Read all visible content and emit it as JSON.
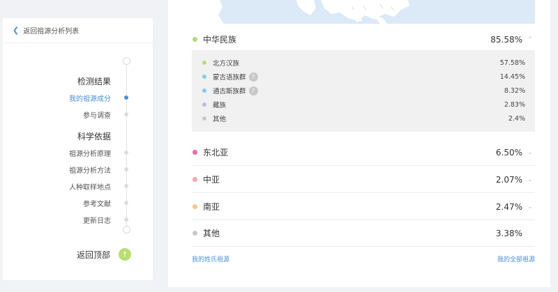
{
  "sidebar": {
    "back_label": "返回祖源分析列表",
    "nav": [
      {
        "label": "检测结果",
        "type": "heading"
      },
      {
        "label": "我的祖源成分",
        "type": "item",
        "active": true
      },
      {
        "label": "参与调查",
        "type": "item"
      },
      {
        "label": "科学依据",
        "type": "heading"
      },
      {
        "label": "祖源分析原理",
        "type": "item"
      },
      {
        "label": "祖源分析方法",
        "type": "item"
      },
      {
        "label": "人种取样地点",
        "type": "item"
      },
      {
        "label": "参考文献",
        "type": "item"
      },
      {
        "label": "更新日志",
        "type": "item"
      }
    ],
    "back_top_label": "返回顶部",
    "back_top_color": "#b8dd73"
  },
  "main": {
    "regions": [
      {
        "name": "中华民族",
        "percent": "85.58%",
        "color": "#b5dc78",
        "expanded": true,
        "icon": "chevron-up-icon"
      },
      {
        "name": "东北亚",
        "percent": "6.50%",
        "color": "#e968a6",
        "icon": "chevron-down-icon"
      },
      {
        "name": "中亚",
        "percent": "2.07%",
        "color": "#f7a8a8",
        "icon": "chevron-down-icon"
      },
      {
        "name": "南亚",
        "percent": "2.47%",
        "color": "#f9c48d",
        "icon": "chevron-down-icon"
      },
      {
        "name": "其他",
        "percent": "3.38%",
        "color": "#c8c8c8"
      }
    ],
    "subgroups": [
      {
        "name": "北方汉族",
        "percent": "57.58%",
        "color": "#b5dc78"
      },
      {
        "name": "蒙古语族群",
        "percent": "14.45%",
        "color": "#7fd3dc",
        "help": "?"
      },
      {
        "name": "通古斯族群",
        "percent": "8.32%",
        "color": "#8cc3ee",
        "help": "?"
      },
      {
        "name": "藏族",
        "percent": "2.83%",
        "color": "#c7b7e6"
      },
      {
        "name": "其他",
        "percent": "2.4%",
        "color": "#c8c8c8"
      }
    ],
    "footer": {
      "left_link": "我的姓氏祖源",
      "right_link": "我的全部祖源"
    },
    "accent_color": "#4a90d9"
  }
}
